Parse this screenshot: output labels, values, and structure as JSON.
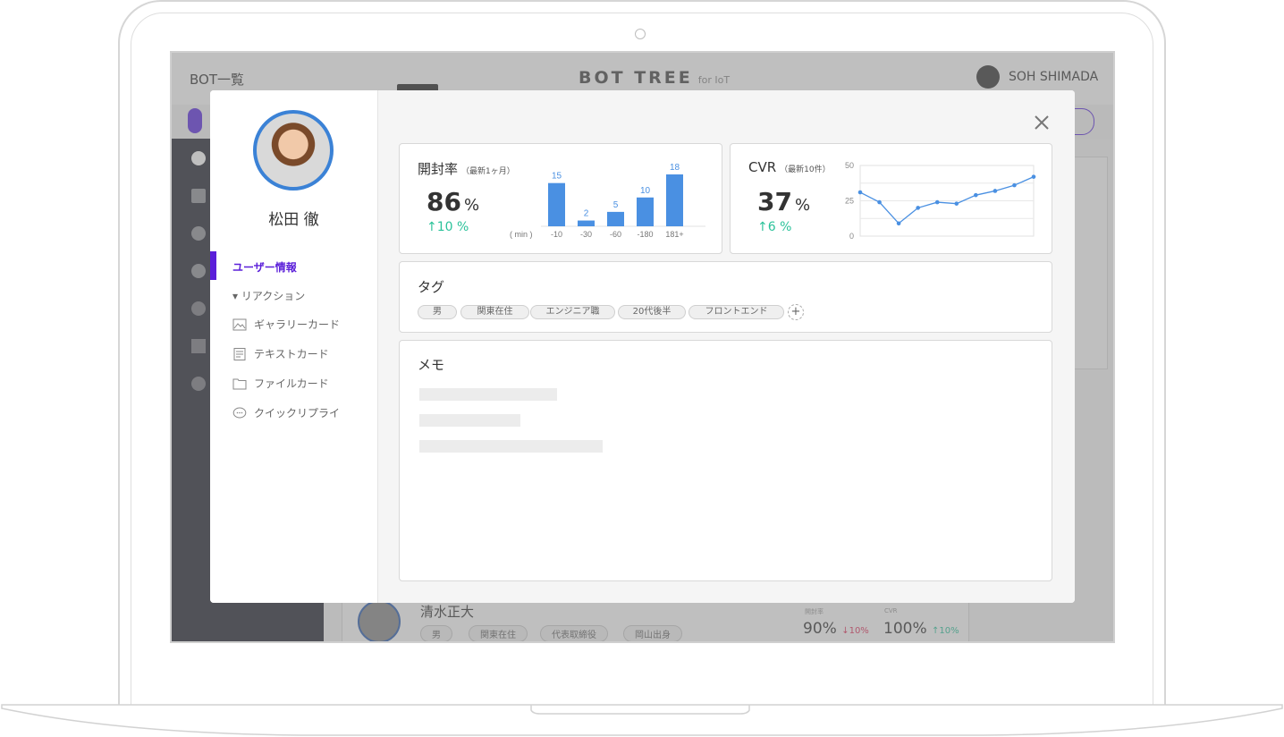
{
  "app": {
    "title_left": "BOT一覧",
    "brand": "BOT TREE",
    "brand_suffix": "for IoT",
    "user_name": "SOH SHIMADA"
  },
  "background_row": {
    "name": "清水正大",
    "tags": [
      "男",
      "関東在住",
      "代表取締役",
      "岡山出身"
    ],
    "open_label": "開封率",
    "open_value": "90%",
    "open_delta": "↓10%",
    "cvr_label": "CVR",
    "cvr_value": "100%",
    "cvr_delta": "↑10%"
  },
  "modal": {
    "profile_name": "松田 徹",
    "nav": {
      "user_info": "ユーザー情報",
      "reaction": "▾ リアクション",
      "gallery_card": "ギャラリーカード",
      "text_card": "テキストカード",
      "file_card": "ファイルカード",
      "quick_reply": "クイックリプライ"
    },
    "open_rate": {
      "title": "開封率",
      "subtitle": "（最新1ヶ月）",
      "value": "86",
      "unit": "%",
      "delta": "↑10 %"
    },
    "cvr": {
      "title": "CVR",
      "subtitle": "（最新10件）",
      "value": "37",
      "unit": "%",
      "delta": "↑6 %"
    },
    "tags": {
      "title": "タグ",
      "items": [
        "男",
        "関東在住",
        "エンジニア職",
        "20代後半",
        "フロントエンド"
      ],
      "add": "+"
    },
    "memo": {
      "title": "メモ"
    }
  },
  "colors": {
    "accent": "#5b1fd9",
    "bar": "#4a90e2",
    "positive": "#2bc29a",
    "negative": "#e0305a"
  },
  "chart_data": [
    {
      "type": "bar",
      "xlabel": "( min )",
      "categories": [
        "-10",
        "-30",
        "-60",
        "-180",
        "181+"
      ],
      "values": [
        15,
        2,
        5,
        10,
        18
      ],
      "ylim": [
        0,
        18
      ]
    },
    {
      "type": "line",
      "x": [
        1,
        2,
        3,
        4,
        5,
        6,
        7,
        8,
        9,
        10
      ],
      "values": [
        31,
        24,
        9,
        20,
        24,
        23,
        29,
        32,
        36,
        42
      ],
      "ylim": [
        0,
        50
      ],
      "yticks": [
        "50",
        "25",
        "0"
      ],
      "grid": true
    }
  ]
}
